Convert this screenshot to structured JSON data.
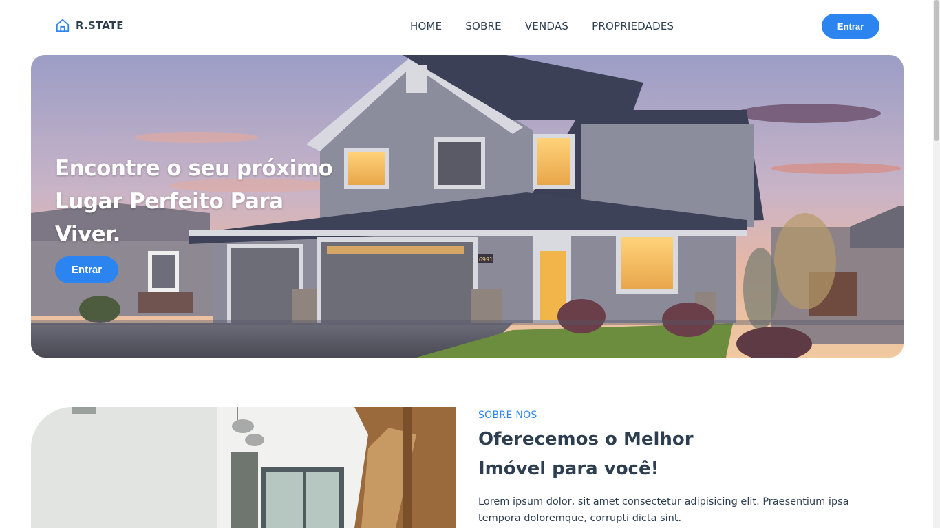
{
  "brand": {
    "name": "R.STATE",
    "icon": "house-icon",
    "accent": "#2b84f0"
  },
  "nav": {
    "items": [
      {
        "label": "HOME"
      },
      {
        "label": "SOBRE"
      },
      {
        "label": "VENDAS"
      },
      {
        "label": "PROPRIEDADES"
      }
    ]
  },
  "header": {
    "login_label": "Entrar"
  },
  "hero": {
    "title": "Encontre o seu próximo Lugar Perfeito Para Viver.",
    "button_label": "Entrar",
    "house_number": "6991"
  },
  "about": {
    "kicker": "SOBRE NOS",
    "title": "Oferecemos o Melhor Imóvel para você!",
    "text": "Lorem ipsum dolor, sit amet consectetur adipisicing elit. Praesentium ipsa tempora doloremque, corrupti dicta sint."
  }
}
